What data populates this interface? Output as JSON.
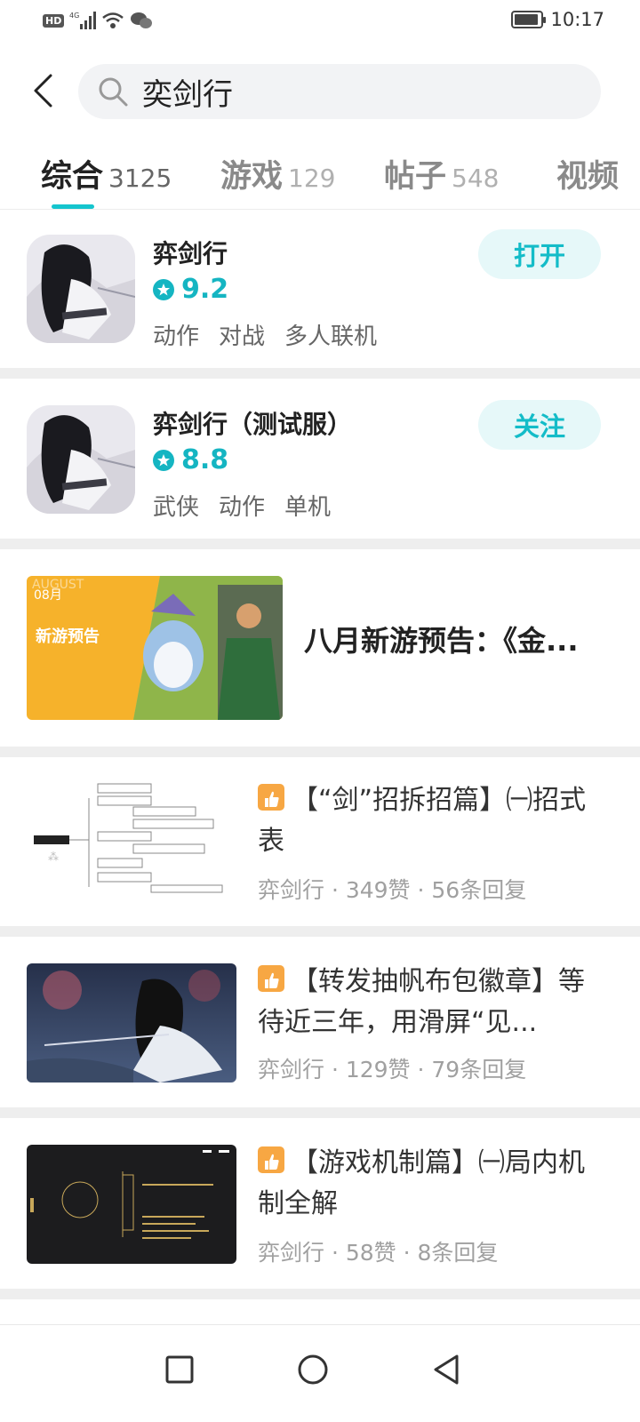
{
  "status_bar": {
    "time": "10:17",
    "network": "HD",
    "signal": "4G",
    "battery_level": 0.9
  },
  "search": {
    "query": "奕剑行"
  },
  "tabs": [
    {
      "label": "综合",
      "count": "3125"
    },
    {
      "label": "游戏",
      "count": "129"
    },
    {
      "label": "帖子",
      "count": "548"
    },
    {
      "label": "视频",
      "count": ""
    }
  ],
  "games": [
    {
      "name": "弈剑行",
      "rating": "9.2",
      "tags": [
        "动作",
        "对战",
        "多人联机"
      ],
      "action": "打开"
    },
    {
      "name": "弈剑行（测试服）",
      "rating": "8.8",
      "tags": [
        "武侠",
        "动作",
        "单机"
      ],
      "action": "关注"
    }
  ],
  "article": {
    "title": "八月新游预告：《金...",
    "banner": {
      "month_text": "08月",
      "overlay_text": "AUGUST",
      "label": "新游预告"
    }
  },
  "posts": [
    {
      "title": "【“剑”招拆招篇】㈠招式表",
      "meta": "弈剑行 · 349赞 · 56条回复"
    },
    {
      "title": "【转发抽帆布包徽章】等待近三年，用滑屏“见...",
      "meta": "弈剑行 · 129赞 · 79条回复"
    },
    {
      "title": "【游戏机制篇】㈠局内机制全解",
      "meta": "弈剑行 · 58赞 · 8条回复"
    }
  ],
  "colors": {
    "accent": "#15c5ce",
    "rating": "#15b5c2",
    "badge": "#f7a743"
  },
  "icons": [
    "back-arrow-icon",
    "search-icon",
    "star-icon",
    "thumb-up-icon",
    "square-icon",
    "circle-icon",
    "triangle-back-icon"
  ]
}
